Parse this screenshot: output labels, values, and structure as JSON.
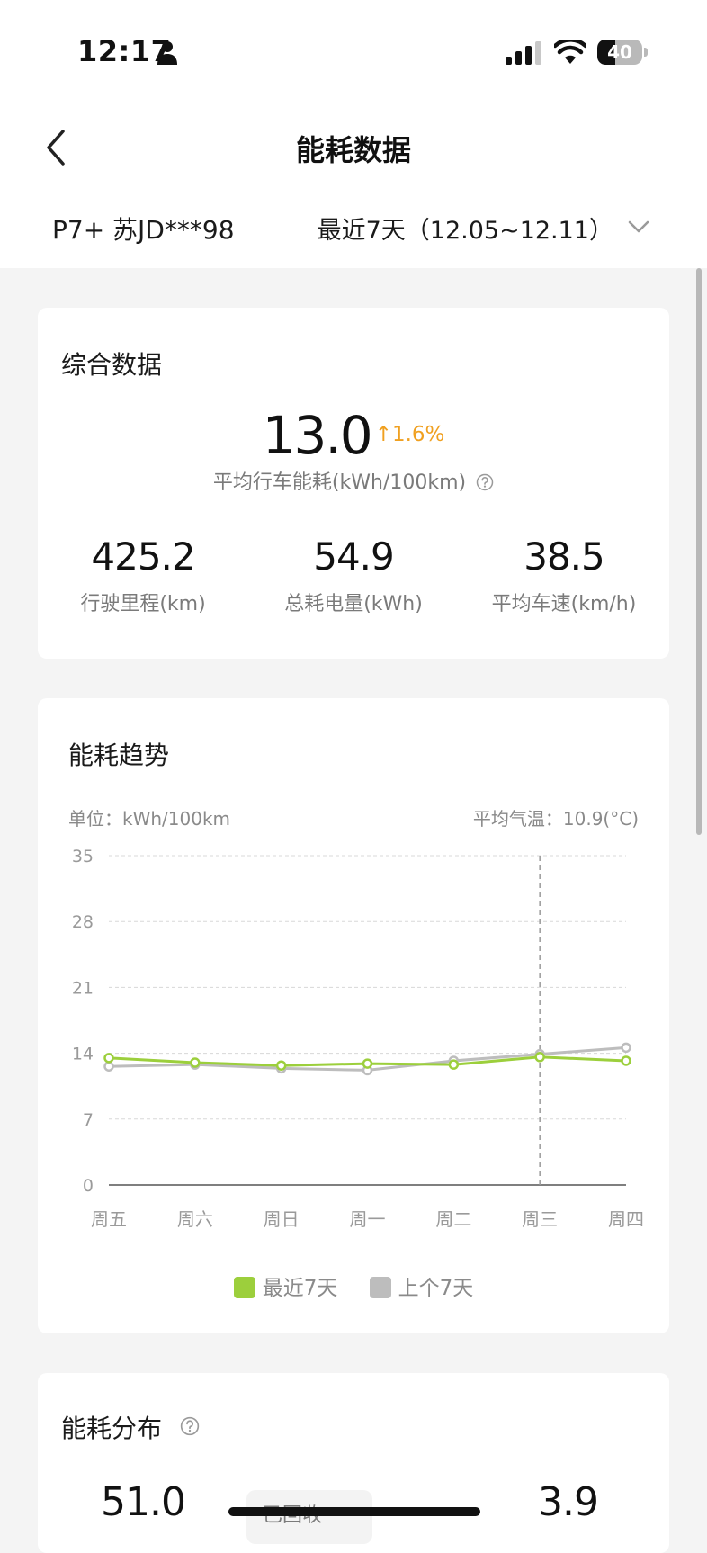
{
  "status_bar": {
    "time": "12:17",
    "battery": "40",
    "battery_level": 0.4
  },
  "nav": {
    "title": "能耗数据"
  },
  "vehicle": {
    "label": "P7+ 苏JD***98",
    "date_range": "最近7天（12.05~12.11）"
  },
  "summary": {
    "title": "综合数据",
    "main_value": "13.0",
    "trend": "↑1.6%",
    "main_label": "平均行车能耗(kWh/100km)",
    "stats": [
      {
        "value": "425.2",
        "label": "行驶里程(km)"
      },
      {
        "value": "54.9",
        "label": "总耗电量(kWh)"
      },
      {
        "value": "38.5",
        "label": "平均车速(km/h)"
      }
    ]
  },
  "trend_card": {
    "title": "能耗趋势",
    "unit_label": "单位：kWh/100km",
    "temp_label": "平均气温：10.9(°C)"
  },
  "distribution": {
    "title": "能耗分布",
    "left_value": "51.0",
    "badge_label": "已回收",
    "right_value": "3.9"
  },
  "colors": {
    "recent": "#9ccf3c",
    "previous": "#bdbdbd",
    "accent_up": "#f0a020"
  },
  "chart_data": {
    "type": "line",
    "categories": [
      "周五",
      "周六",
      "周日",
      "周一",
      "周二",
      "周三",
      "周四"
    ],
    "series": [
      {
        "name": "最近7天",
        "values": [
          13.5,
          13.0,
          12.7,
          12.9,
          12.8,
          13.6,
          13.2
        ]
      },
      {
        "name": "上个7天",
        "values": [
          12.6,
          12.8,
          12.4,
          12.2,
          13.2,
          13.9,
          14.6
        ]
      }
    ],
    "yticks": [
      0,
      7,
      14,
      21,
      28,
      35
    ],
    "ylim": [
      0,
      35
    ],
    "highlight_category": "周三",
    "grid": true,
    "legend_position": "bottom-center"
  }
}
